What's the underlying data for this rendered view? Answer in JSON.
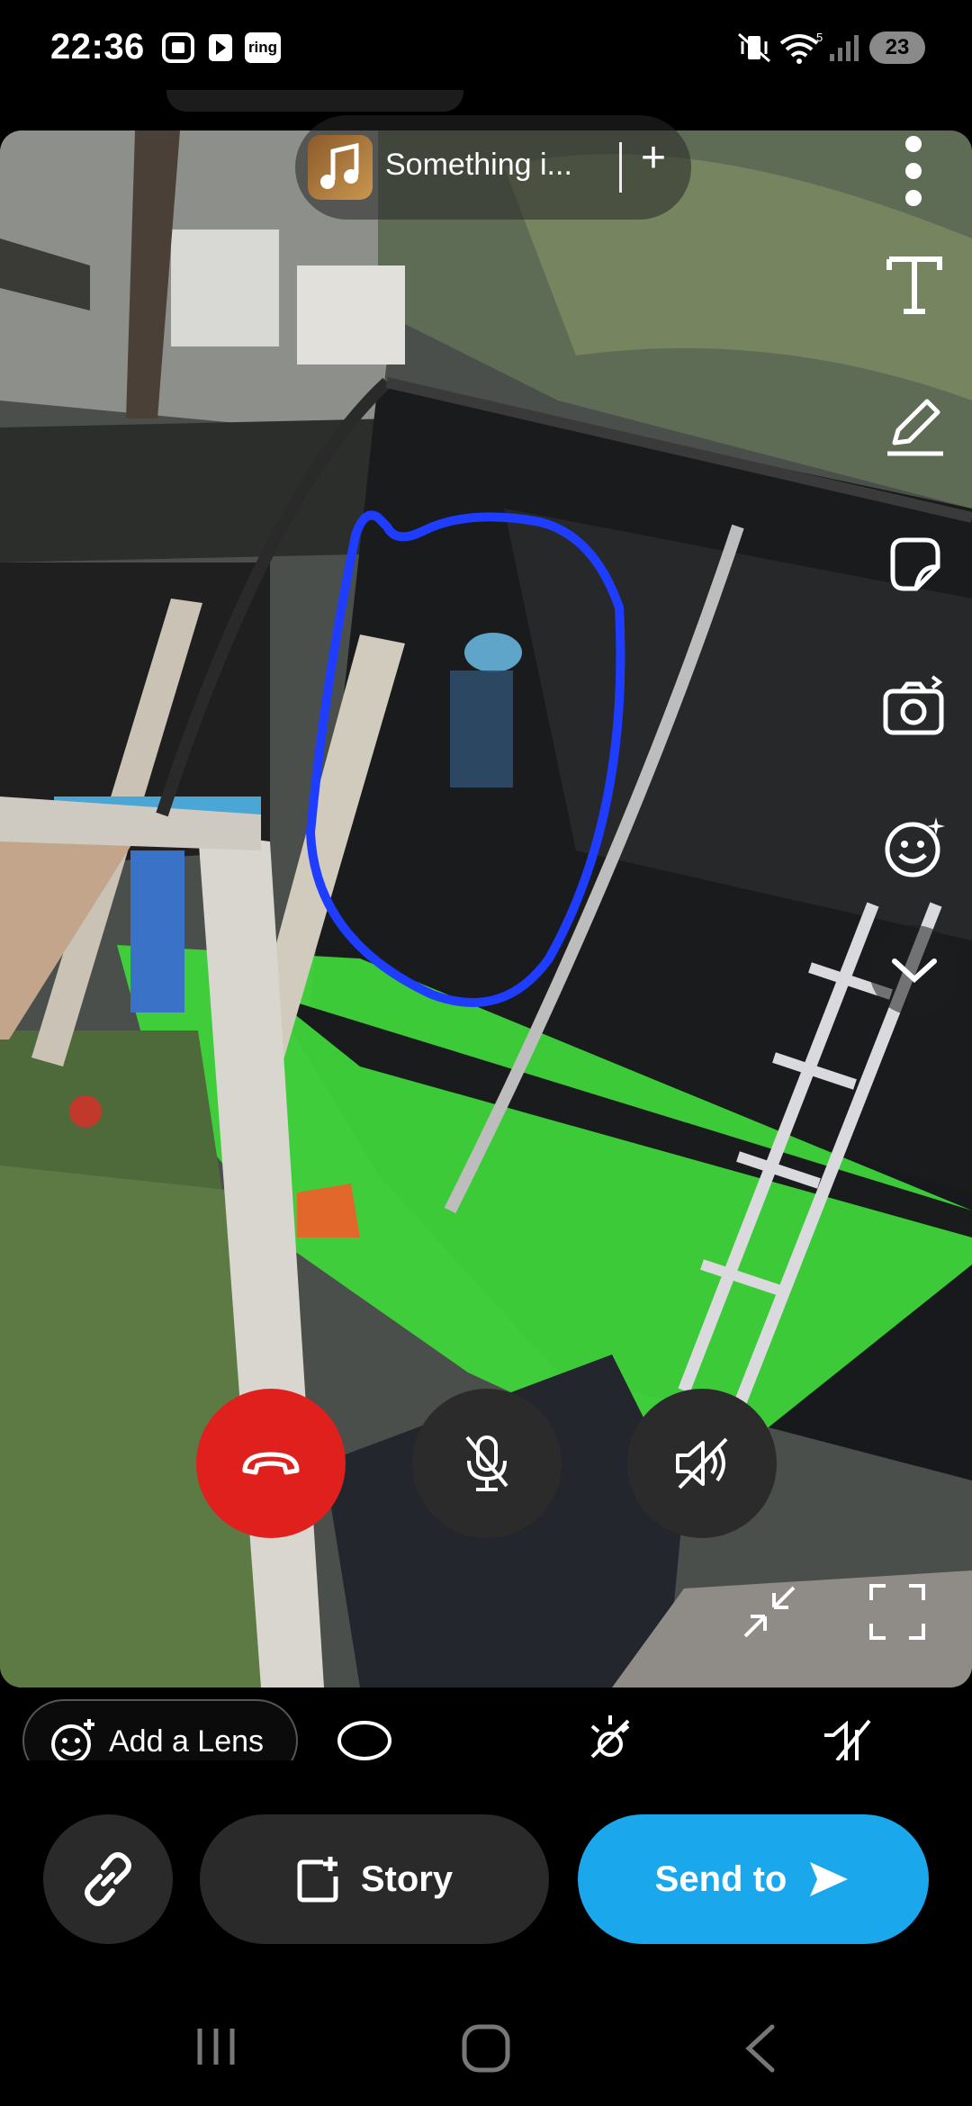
{
  "status_bar": {
    "time": "22:36",
    "ring_label": "ring",
    "battery": "23",
    "wifi_badge": "5"
  },
  "music": {
    "title": "Something i...",
    "add_symbol": "+"
  },
  "toolbar": {
    "icons": [
      "more-options-icon",
      "text-icon",
      "draw-icon",
      "sticker-icon",
      "camera-flip-icon",
      "lens-icon",
      "expand-chevron-icon"
    ]
  },
  "call": {
    "end_color": "#e0201c"
  },
  "lens_bar": {
    "add_lens_label": "Add a Lens"
  },
  "actions": {
    "story_label": "Story",
    "send_label": "Send to",
    "send_color": "#1aa7ec"
  }
}
